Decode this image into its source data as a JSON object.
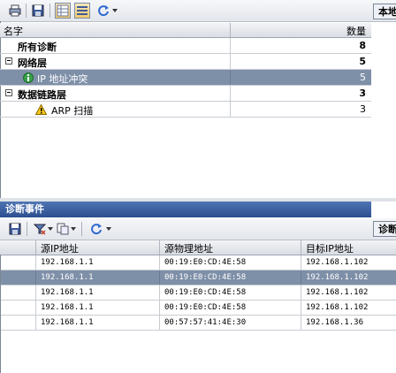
{
  "top_toolbar": {
    "side_tab_label": "本地",
    "icons": [
      "print-icon",
      "save-icon",
      "grid-icon",
      "list-icon",
      "refresh-icon"
    ]
  },
  "diagnosis_grid": {
    "columns": {
      "name": "名字",
      "count": "数量"
    },
    "rows": [
      {
        "label": "所有诊断",
        "count": "8",
        "type": "group"
      },
      {
        "label": "网络层",
        "count": "5",
        "type": "group"
      },
      {
        "label": "IP 地址冲突",
        "count": "5",
        "type": "item",
        "selected": true,
        "icon": "info-icon"
      },
      {
        "label": "数据链路层",
        "count": "3",
        "type": "group"
      },
      {
        "label": "ARP 扫描",
        "count": "3",
        "type": "item",
        "icon": "warning-icon"
      }
    ]
  },
  "events_panel": {
    "title": "诊断事件",
    "side_tab_label": "诊断",
    "columns": {
      "src_ip": "源IP地址",
      "src_mac": "源物理地址",
      "dst_ip": "目标IP地址"
    },
    "rows": [
      {
        "src_ip": "192.168.1.1",
        "src_mac": "00:19:E0:CD:4E:58",
        "dst_ip": "192.168.1.102",
        "selected": false
      },
      {
        "src_ip": "192.168.1.1",
        "src_mac": "00:19:E0:CD:4E:58",
        "dst_ip": "192.168.1.102",
        "selected": true
      },
      {
        "src_ip": "192.168.1.1",
        "src_mac": "00:19:E0:CD:4E:58",
        "dst_ip": "192.168.1.102",
        "selected": false
      },
      {
        "src_ip": "192.168.1.1",
        "src_mac": "00:19:E0:CD:4E:58",
        "dst_ip": "192.168.1.102",
        "selected": false
      },
      {
        "src_ip": "192.168.1.1",
        "src_mac": "00:57:57:41:4E:30",
        "dst_ip": "192.168.1.36",
        "selected": false
      }
    ]
  }
}
